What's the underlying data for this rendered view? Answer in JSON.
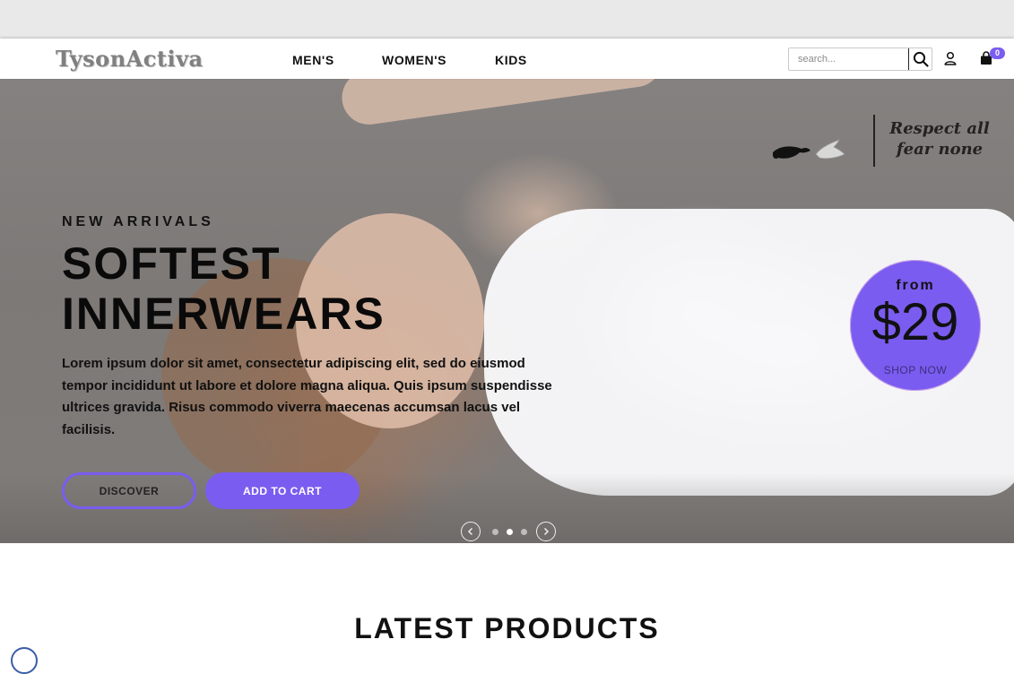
{
  "header": {
    "logo": "TysonActiva",
    "nav": [
      "MEN'S",
      "WOMEN'S",
      "KIDS"
    ],
    "search": {
      "placeholder": "search..."
    },
    "cart_count": "0",
    "icons": [
      "search-icon",
      "user-icon",
      "shopping-bag-icon"
    ]
  },
  "hero": {
    "brand_tagline": "Respect all fear none",
    "eyebrow": "NEW ARRIVALS",
    "headline_line1": "SOFTEST",
    "headline_line2": "INNERWEARS",
    "body": "Lorem ipsum dolor sit amet, consectetur adipiscing elit, sed do eiusmod tempor incididunt ut labore et dolore magna aliqua. Quis ipsum suspendisse ultrices gravida. Risus commodo viverra maecenas accumsan lacus vel facilisis.",
    "discover_label": "DISCOVER",
    "add_to_cart_label": "ADD TO CART",
    "price": {
      "from_label": "from",
      "value": "$29",
      "cta": "SHOP NOW"
    },
    "slider": {
      "slide_count": 3,
      "active_slide": 2
    }
  },
  "latest_products": {
    "title": "LATEST PRODUCTS"
  },
  "colors": {
    "accent": "#7b5cf0",
    "text": "#111111",
    "nav_bg": "#ffffff",
    "top_strip": "#e9e9e9"
  }
}
